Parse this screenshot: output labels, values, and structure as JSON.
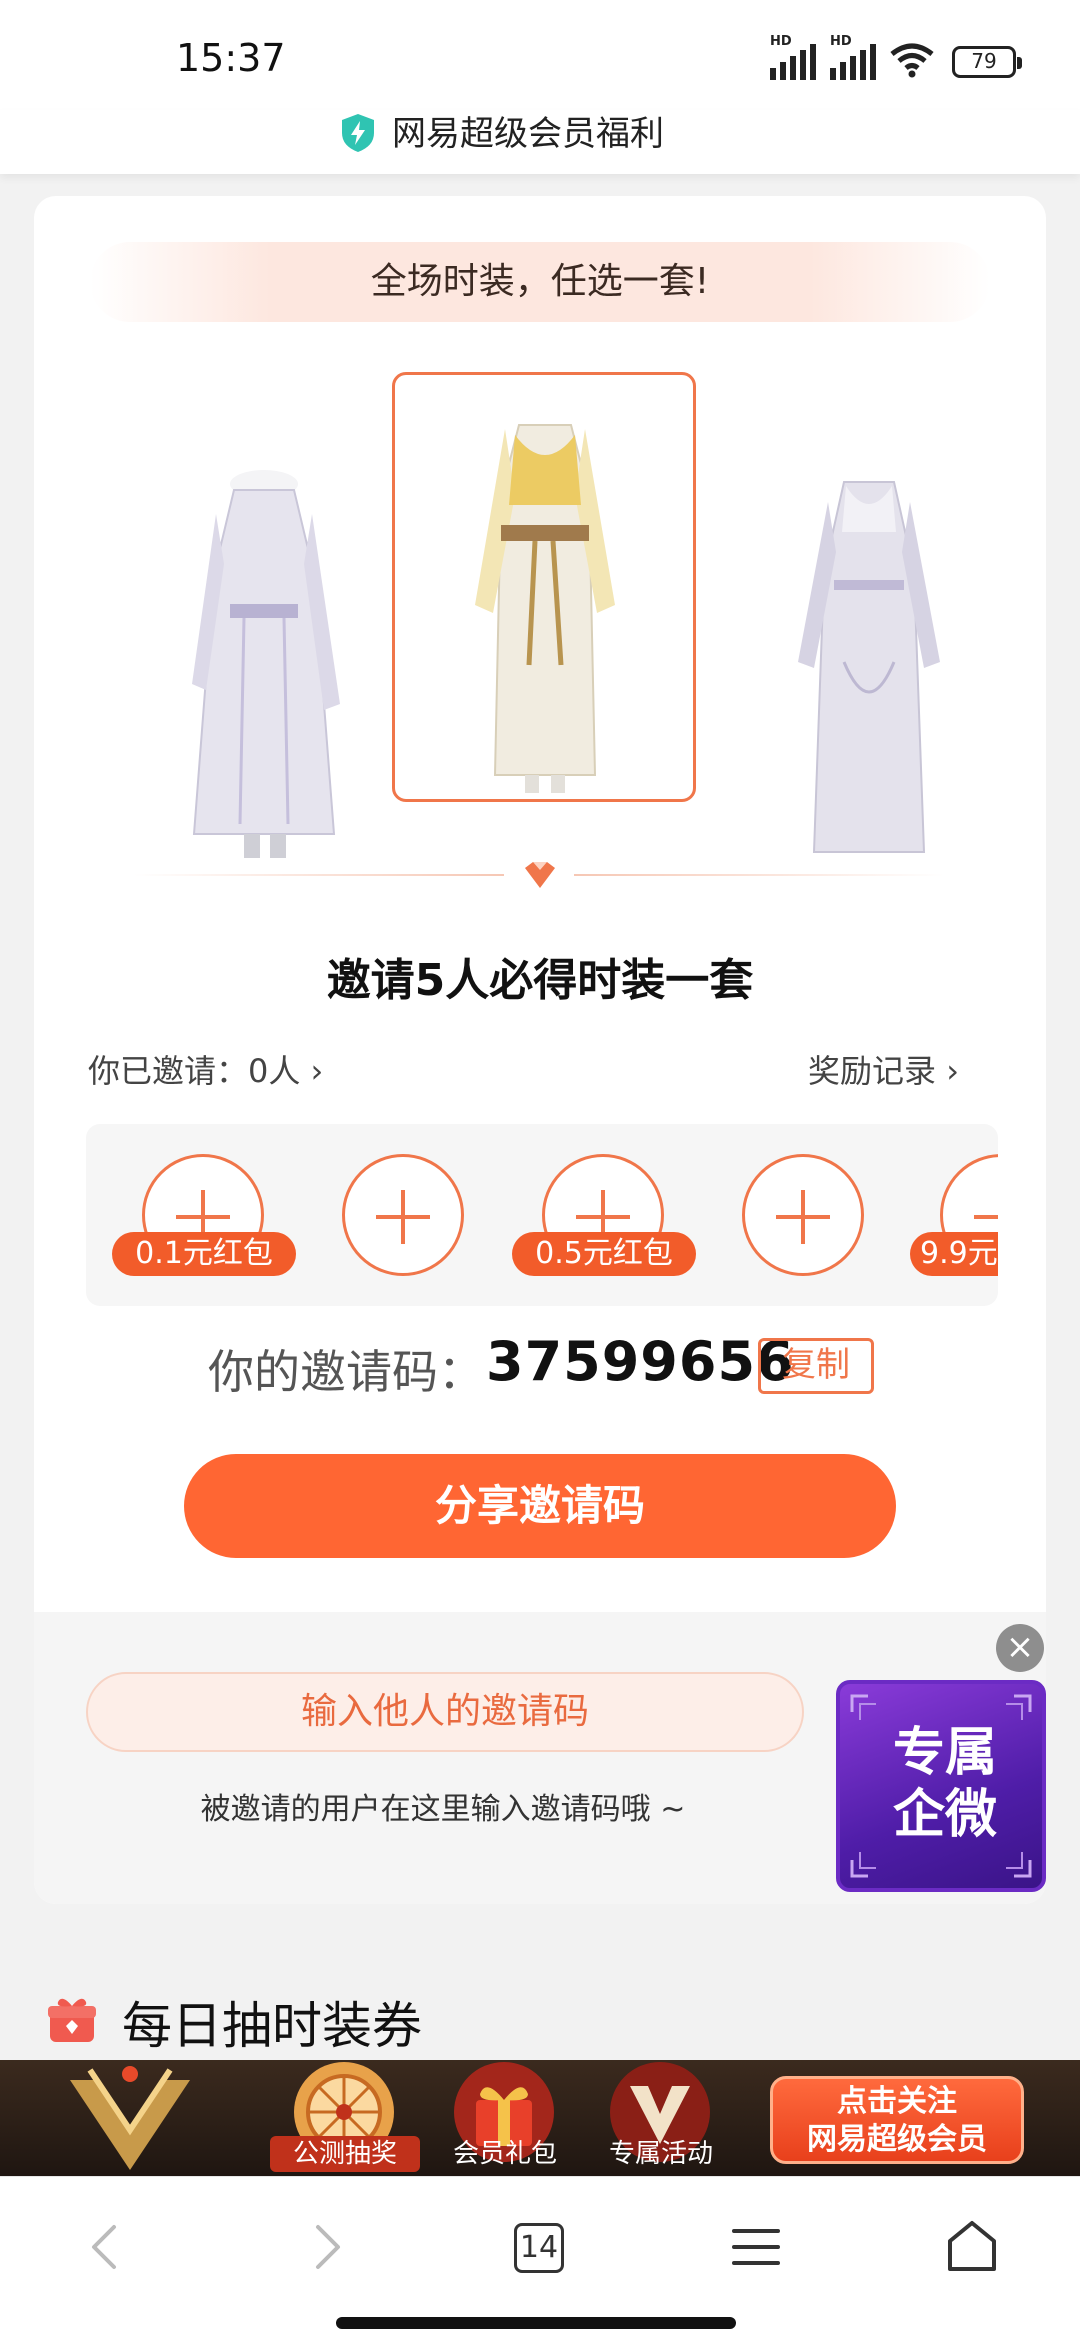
{
  "status_bar": {
    "time": "15:37",
    "signal1_label": "HD",
    "signal2_label": "HD",
    "battery": "79"
  },
  "title_bar": {
    "title": "网易超级会员福利",
    "icon": "shield-bolt-icon"
  },
  "banner": {
    "text": "全场时装，任选一套!"
  },
  "outfits": [
    {
      "name": "white-gown-left",
      "selected": false
    },
    {
      "name": "gold-gown-center",
      "selected": true
    },
    {
      "name": "silver-gown-right",
      "selected": false
    }
  ],
  "invite": {
    "headline": "邀请5人必得时装一套",
    "invited_label": "你已邀请：0人",
    "rewards_label": "奖励记录",
    "slots": [
      {
        "reward": "0.1元红包"
      },
      {
        "reward": ""
      },
      {
        "reward": "0.5元红包"
      },
      {
        "reward": ""
      },
      {
        "reward": "9.9元"
      }
    ],
    "code_label": "你的邀请码：",
    "code_value": "37599656",
    "copy_label": "复制",
    "share_label": "分享邀请码"
  },
  "enter_code": {
    "button_label": "输入他人的邀请码",
    "hint": "被邀请的用户在这里输入邀请码哦 ~"
  },
  "float_badge": {
    "line1": "专属",
    "line2": "企微",
    "close": "×"
  },
  "daily": {
    "title": "每日抽时装券",
    "icon": "gift-icon"
  },
  "promo_bar": {
    "items": [
      {
        "label": "公测抽奖",
        "icon": "wheel-icon"
      },
      {
        "label": "会员礼包",
        "icon": "gift-box-icon"
      },
      {
        "label": "专属活动",
        "icon": "v-emblem-icon"
      }
    ],
    "cta_line1": "点击关注",
    "cta_line2": "网易超级会员"
  },
  "nav": {
    "tab_count": "14"
  },
  "colors": {
    "accent": "#ff6633",
    "accent_border": "#f0764a",
    "pill": "#f25c2a",
    "badge_purple": "#5b22b5"
  }
}
